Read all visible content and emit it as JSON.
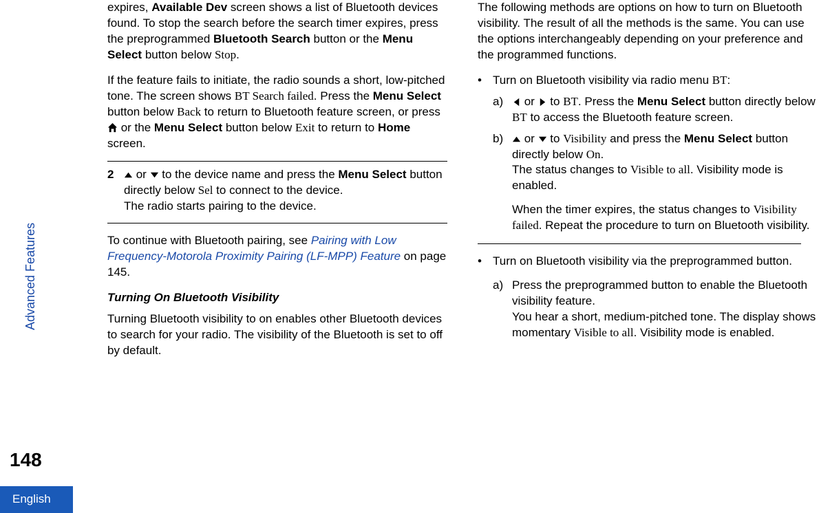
{
  "rail": {
    "section": "Advanced Features",
    "page_number": "148",
    "language": "English"
  },
  "col1": {
    "p1a": "expires, ",
    "p1b": "Available Dev",
    "p1c": " screen shows a list of Bluetooth devices found. To stop the search before the search timer expires, press the preprogrammed ",
    "p1d": "Bluetooth Search",
    "p1e": " button or the ",
    "p1f": "Menu Select",
    "p1g": " button below ",
    "p1h": "Stop",
    "p1i": ".",
    "p2a": "If the feature fails to initiate, the radio sounds a short, low-pitched tone. The screen shows ",
    "p2b": "BT Search failed",
    "p2c": ". Press the ",
    "p2d": "Menu Select",
    "p2e": " button below ",
    "p2f": "Back",
    "p2g": " to return to Bluetooth feature screen, or press ",
    "p2h": " or the ",
    "p2i": "Menu Select",
    "p2j": " button below ",
    "p2k": "Exit",
    "p2l": " to return to ",
    "p2m": "Home",
    "p2n": " screen.",
    "step2_num": "2",
    "s2a": " or ",
    "s2b": " to the device name and press the ",
    "s2c": "Menu Select",
    "s2d": " button directly below ",
    "s2e": "Sel",
    "s2f": " to connect to the device.",
    "s2g": "The radio starts pairing to the device.",
    "p3a": "To continue with Bluetooth pairing, see ",
    "p3b": "Pairing with Low Frequency-Motorola Proximity Pairing (LF-MPP) Feature",
    "p3c": " on page 145.",
    "sub1": "Turning On Bluetooth Visibility",
    "p4": "Turning Bluetooth visibility to on enables other Bluetooth devices to search for your radio. The visibility of the Bluetooth is set to off by default."
  },
  "col2": {
    "p1": "The following methods are options on how to turn on Bluetooth visibility. The result of all the methods is the same. You can use the options interchangeably depending on your preference and the programmed functions.",
    "b1a": "Turn on Bluetooth visibility via radio menu ",
    "b1b": "BT",
    "b1c": ":",
    "b1s1_label": "a)",
    "b1s1a": " or ",
    "b1s1b": " to ",
    "b1s1c": "BT",
    "b1s1d": ". Press the ",
    "b1s1e": "Menu Select",
    "b1s1f": " button directly below ",
    "b1s1g": "BT",
    "b1s1h": " to access the Bluetooth feature screen.",
    "b1s2_label": "b)",
    "b1s2a": " or ",
    "b1s2b": " to ",
    "b1s2c": "Visibility",
    "b1s2d": " and press the ",
    "b1s2e": "Menu Select",
    "b1s2f": " button directly below ",
    "b1s2g": "On",
    "b1s2h": ".",
    "b1s2i": "The status changes to ",
    "b1s2j": "Visible to all",
    "b1s2k": ". Visibility mode is enabled.",
    "b1s2l": "When the timer expires, the status changes to ",
    "b1s2m": "Visibility failed",
    "b1s2n": ". Repeat the procedure to turn on Bluetooth visibility.",
    "b2a": "Turn on Bluetooth visibility via the preprogrammed button.",
    "b2s1_label": "a)",
    "b2s1a": "Press the preprogrammed button to enable the Bluetooth visibility feature.",
    "b2s1b": "You hear a short, medium-pitched tone. The display shows momentary ",
    "b2s1c": "Visible to all",
    "b2s1d": ". Visibility mode is enabled."
  }
}
